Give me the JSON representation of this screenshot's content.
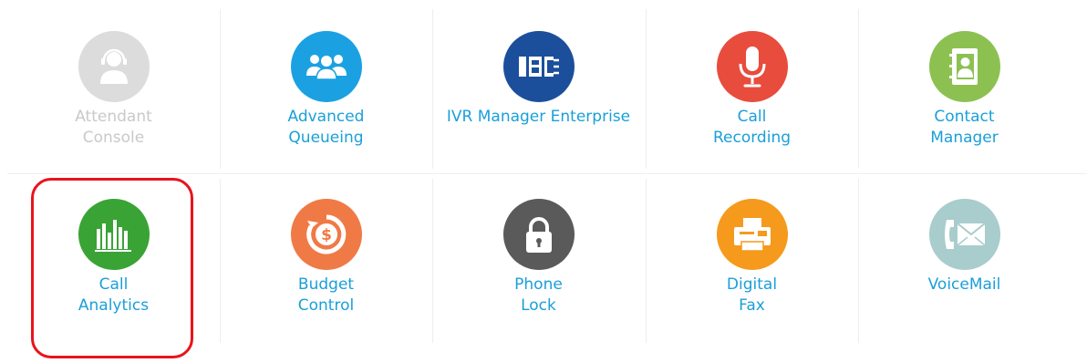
{
  "features": [
    {
      "id": "attendant-console",
      "lines": [
        "Attendant",
        "Console"
      ],
      "icon": "headset-agent-icon",
      "color": "#dcdcdc",
      "enabled": false
    },
    {
      "id": "advanced-queueing",
      "lines": [
        "Advanced",
        "Queueing"
      ],
      "icon": "group-queue-icon",
      "color": "#1ba1e2",
      "enabled": true
    },
    {
      "id": "ivr-manager-enterprise",
      "lines": [
        "IVR Manager Enterprise"
      ],
      "icon": "ivr-flow-icon",
      "color": "#1b4f9c",
      "enabled": true
    },
    {
      "id": "call-recording",
      "lines": [
        "Call",
        "Recording"
      ],
      "icon": "microphone-icon",
      "color": "#e84c3d",
      "enabled": true
    },
    {
      "id": "contact-manager",
      "lines": [
        "Contact",
        "Manager"
      ],
      "icon": "address-book-icon",
      "color": "#8cc152",
      "enabled": true
    },
    {
      "id": "call-analytics",
      "lines": [
        "Call",
        "Analytics"
      ],
      "icon": "bar-chart-icon",
      "color": "#3aa335",
      "enabled": true
    },
    {
      "id": "budget-control",
      "lines": [
        "Budget",
        "Control"
      ],
      "icon": "dollar-cycle-icon",
      "color": "#f07a45",
      "enabled": true
    },
    {
      "id": "phone-lock",
      "lines": [
        "Phone",
        "Lock"
      ],
      "icon": "padlock-icon",
      "color": "#5a5a5a",
      "enabled": true
    },
    {
      "id": "digital-fax",
      "lines": [
        "Digital",
        "Fax"
      ],
      "icon": "fax-machine-icon",
      "color": "#f59a1c",
      "enabled": true
    },
    {
      "id": "voicemail",
      "lines": [
        "VoiceMail"
      ],
      "icon": "envelope-phone-icon",
      "color": "#a9cccc",
      "enabled": true
    }
  ],
  "highlighted": "call-analytics",
  "label_color": "#1a9fd9",
  "disabled_label_color": "#c9c9c9",
  "highlight_color": "#e8141c"
}
